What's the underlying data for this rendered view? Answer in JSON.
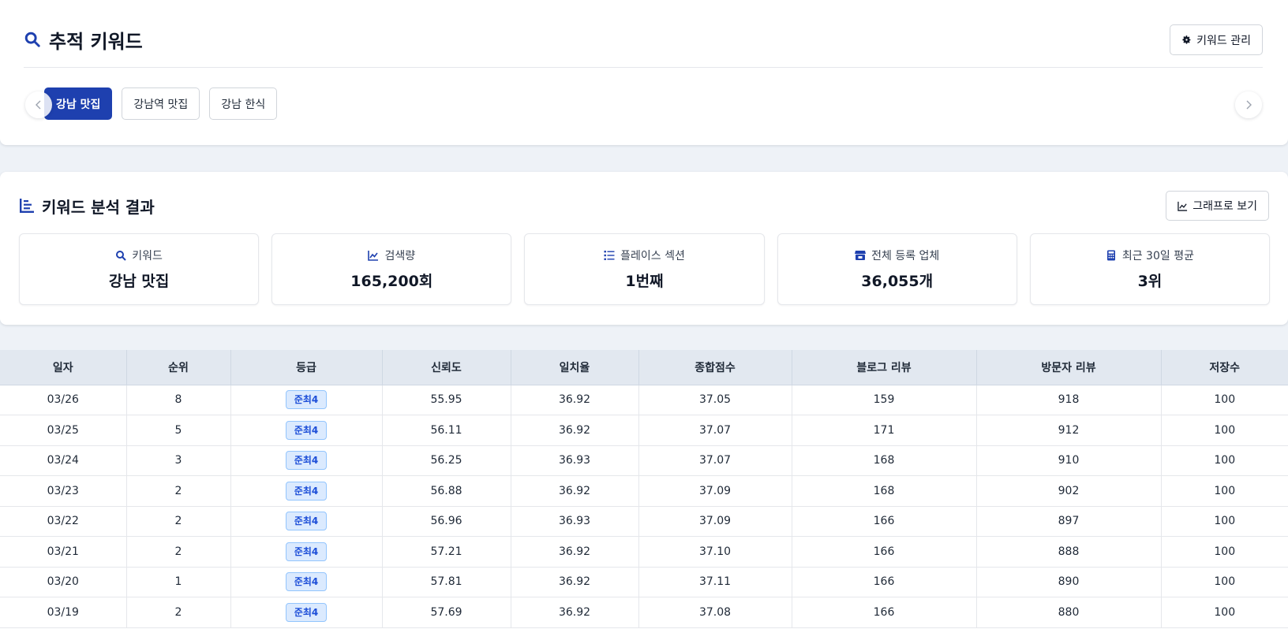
{
  "tracked": {
    "title": "추적 키워드",
    "manage_label": "키워드 관리",
    "chips": [
      "강남 맛집",
      "강남역 맛집",
      "강남 한식"
    ],
    "active_chip": 0
  },
  "analysis": {
    "title": "키워드 분석 결과",
    "graph_label": "그래프로 보기",
    "stats": [
      {
        "icon": "search-icon",
        "label": "키워드",
        "value": "강남 맛집"
      },
      {
        "icon": "line-chart-icon",
        "label": "검색량",
        "value": "165,200회"
      },
      {
        "icon": "ordered-list-icon",
        "label": "플레이스 섹션",
        "value": "1번째"
      },
      {
        "icon": "store-icon",
        "label": "전체 등록 업체",
        "value": "36,055개"
      },
      {
        "icon": "calculator-icon",
        "label": "최근 30일 평균",
        "value": "3위"
      }
    ]
  },
  "table": {
    "columns": [
      "일자",
      "순위",
      "등급",
      "신뢰도",
      "일치율",
      "종합점수",
      "블로그 리뷰",
      "방문자 리뷰",
      "저장수"
    ],
    "rows": [
      [
        "03/26",
        "8",
        "준최4",
        "55.95",
        "36.92",
        "37.05",
        "159",
        "918",
        "100"
      ],
      [
        "03/25",
        "5",
        "준최4",
        "56.11",
        "36.92",
        "37.07",
        "171",
        "912",
        "100"
      ],
      [
        "03/24",
        "3",
        "준최4",
        "56.25",
        "36.93",
        "37.07",
        "168",
        "910",
        "100"
      ],
      [
        "03/23",
        "2",
        "준최4",
        "56.88",
        "36.92",
        "37.09",
        "168",
        "902",
        "100"
      ],
      [
        "03/22",
        "2",
        "준최4",
        "56.96",
        "36.93",
        "37.09",
        "166",
        "897",
        "100"
      ],
      [
        "03/21",
        "2",
        "준최4",
        "57.21",
        "36.92",
        "37.10",
        "166",
        "888",
        "100"
      ],
      [
        "03/20",
        "1",
        "준최4",
        "57.81",
        "36.92",
        "37.11",
        "166",
        "890",
        "100"
      ],
      [
        "03/19",
        "2",
        "준최4",
        "57.69",
        "36.92",
        "37.08",
        "166",
        "880",
        "100"
      ]
    ]
  },
  "colors": {
    "accent": "#1e40af",
    "header_bg": "#e2e8f0",
    "grade_bg": "#dbeafe",
    "grade_text": "#1d4ed8"
  }
}
